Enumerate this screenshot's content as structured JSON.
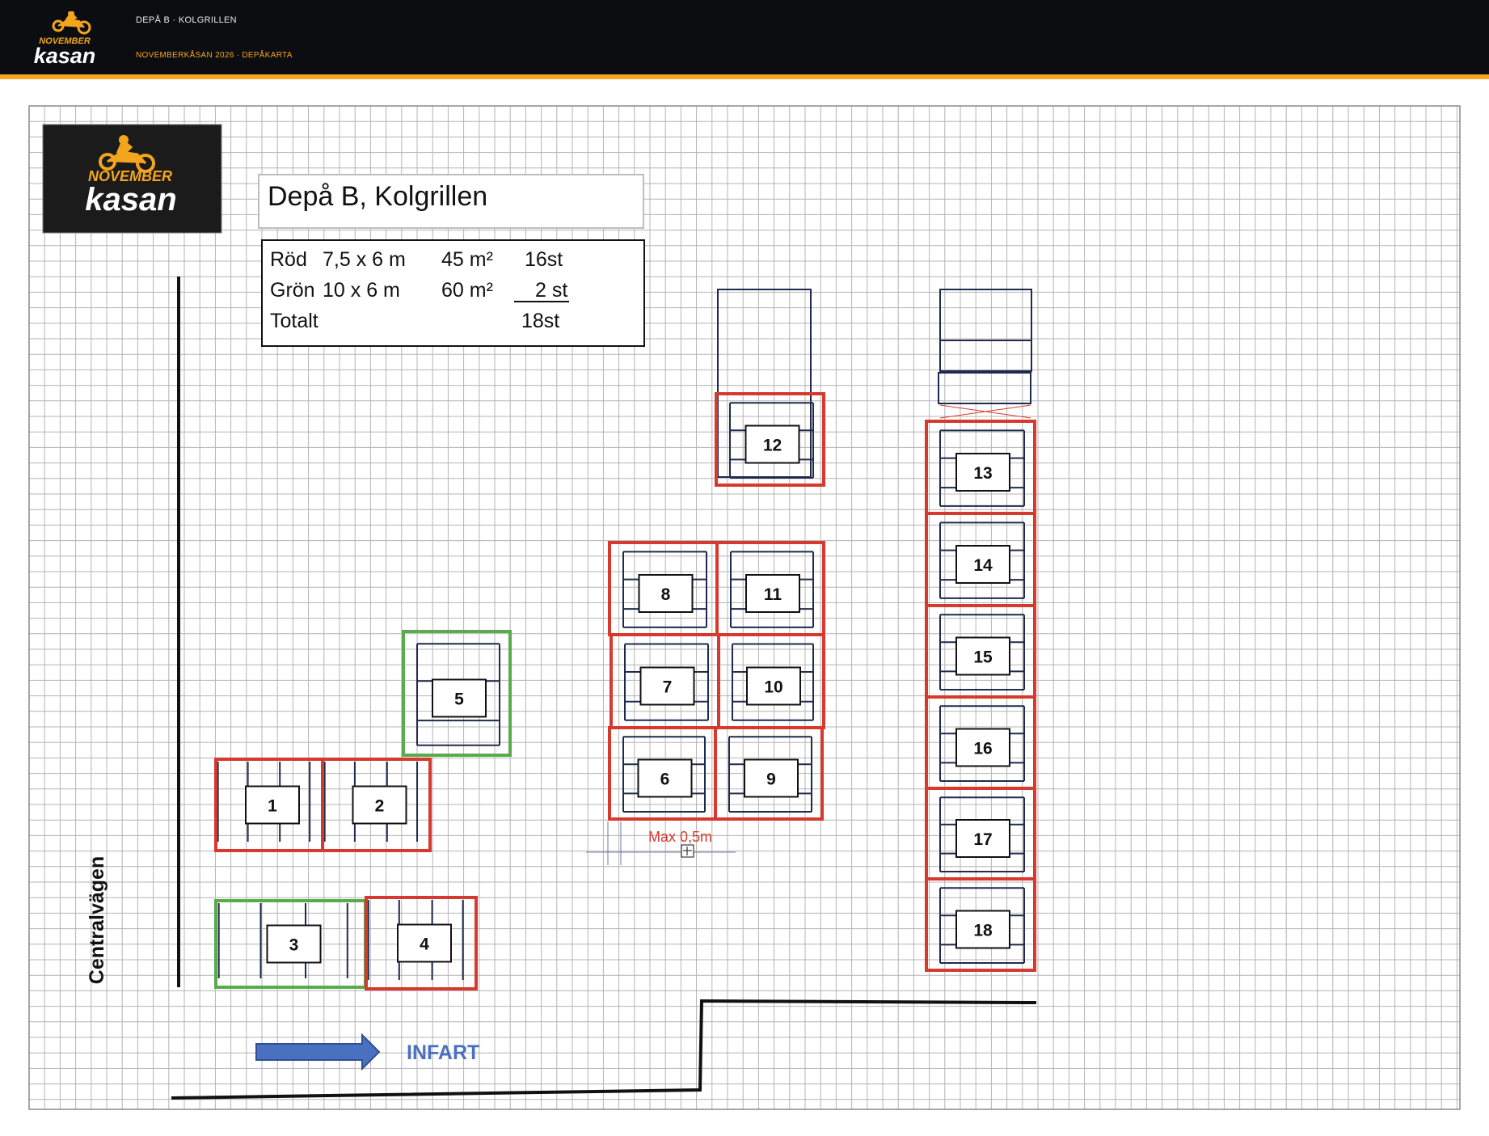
{
  "header": {
    "title": "DEPÅ B · KOLGRILLEN",
    "subtitle": "NOVEMBERKÅSAN 2026 · DEPÅKARTA"
  },
  "logo": {
    "line1": "NOVEMBER",
    "line2": "kasan"
  },
  "map": {
    "title": "Depå B, Kolgrillen",
    "info": {
      "rows": [
        {
          "label": "Röd",
          "size": "7,5 x 6 m",
          "area": "45 m²",
          "count": "16st"
        },
        {
          "label": "Grön",
          "size": "10 x 6 m",
          "area": "60 m²",
          "count": "2 st"
        },
        {
          "label": "Totalt",
          "size": "",
          "area": "",
          "count": "18st"
        }
      ]
    },
    "road_label": "Centralvägen",
    "entry_label": "INFART",
    "measure_label": "Max 0,5m",
    "colors": {
      "red": "#d63a2f",
      "green": "#5aab4c",
      "navy": "#1f2a4d",
      "grid": "#b4b4b4",
      "blue": "#4a70c0"
    },
    "pitches": [
      {
        "number": "1",
        "color": "red"
      },
      {
        "number": "2",
        "color": "red"
      },
      {
        "number": "3",
        "color": "green"
      },
      {
        "number": "4",
        "color": "red"
      },
      {
        "number": "5",
        "color": "green"
      },
      {
        "number": "6",
        "color": "red"
      },
      {
        "number": "7",
        "color": "red"
      },
      {
        "number": "8",
        "color": "red"
      },
      {
        "number": "9",
        "color": "red"
      },
      {
        "number": "10",
        "color": "red"
      },
      {
        "number": "11",
        "color": "red"
      },
      {
        "number": "12",
        "color": "red"
      },
      {
        "number": "13",
        "color": "red"
      },
      {
        "number": "14",
        "color": "red"
      },
      {
        "number": "15",
        "color": "red"
      },
      {
        "number": "16",
        "color": "red"
      },
      {
        "number": "17",
        "color": "red"
      },
      {
        "number": "18",
        "color": "red"
      }
    ]
  }
}
